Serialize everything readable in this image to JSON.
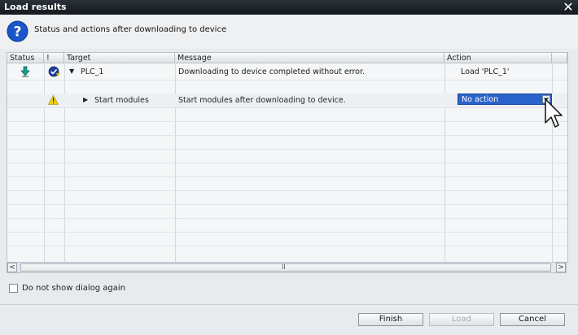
{
  "window": {
    "title": "Load results"
  },
  "header": {
    "text": "Status and actions after downloading to device"
  },
  "grid": {
    "columns": [
      "Status",
      "!",
      "Target",
      "Message",
      "Action"
    ],
    "rows": [
      {
        "target": "PLC_1",
        "message": "Downloading to device completed without error.",
        "action": "Load 'PLC_1'",
        "expanded": true
      },
      {
        "target": "Start modules",
        "message": "Start modules after downloading to device.",
        "action": "No action",
        "expanded": false
      }
    ]
  },
  "scrollbar": {
    "thumb_label": "II"
  },
  "checkbox": {
    "label": "Do not show dialog again",
    "checked": false
  },
  "buttons": {
    "finish": "Finish",
    "load": "Load",
    "cancel": "Cancel"
  },
  "icons": {
    "close": "close-icon",
    "help": "help-icon",
    "download": "download-icon",
    "success": "success-icon",
    "warning": "warning-icon"
  },
  "colors": {
    "selection_blue": "#2a63c9",
    "help_blue": "#1a55c9",
    "warning_yellow": "#f5d400"
  }
}
